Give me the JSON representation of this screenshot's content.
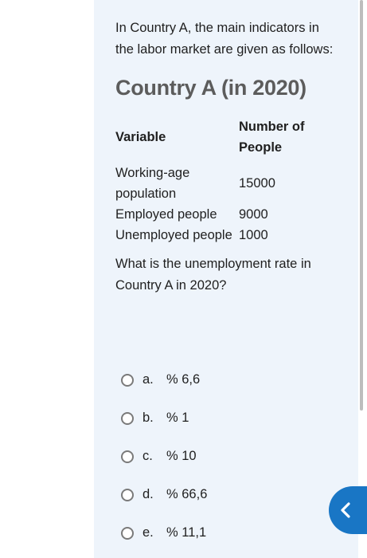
{
  "question": {
    "intro": "In Country A, the main indicators in the labor market are given as follows:",
    "table_title": "Country A (in 2020)",
    "table": {
      "headers": [
        "Variable",
        "Number of People"
      ],
      "rows": [
        {
          "variable": "Working-age population",
          "value": "15000"
        },
        {
          "variable": "Employed people",
          "value": "9000"
        },
        {
          "variable": "Unemployed people",
          "value": "1000"
        }
      ]
    },
    "prompt": "What is the unemployment rate in Country A in 2020?"
  },
  "options": [
    {
      "letter": "a.",
      "text": "% 6,6"
    },
    {
      "letter": "b.",
      "text": "% 1"
    },
    {
      "letter": "c.",
      "text": "% 10"
    },
    {
      "letter": "d.",
      "text": "% 66,6"
    },
    {
      "letter": "e.",
      "text": "% 11,1"
    }
  ],
  "icons": {
    "back_button": "chevron-left-icon"
  },
  "colors": {
    "panel_bg": "#eef4fb",
    "accent": "#1976c5",
    "heading": "#5c5c5c"
  }
}
